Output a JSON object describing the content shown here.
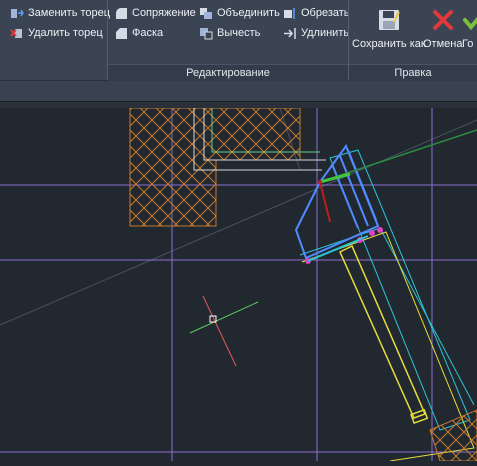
{
  "ribbon": {
    "cmd_replace_end": "Заменить торец",
    "cmd_delete_end": "Удалить торец",
    "cmd_fillet": "Сопряжение",
    "cmd_chamfer": "Фаска",
    "cmd_union": "Объединить",
    "cmd_subtract": "Вычесть",
    "cmd_trim": "Обрезать",
    "cmd_extend": "Удлинить",
    "cmd_save_as": "Сохранить как",
    "cmd_cancel": "Отмена",
    "cmd_done_partial": "Го",
    "panel_edit": "Редактирование",
    "panel_edit_title": "Правка"
  },
  "icons": {
    "replace_end": "replace-end-icon",
    "delete_end": "delete-end-icon",
    "fillet": "fillet-icon",
    "chamfer": "chamfer-icon",
    "union": "union-icon",
    "subtract": "subtract-icon",
    "trim": "trim-icon",
    "extend": "extend-icon",
    "save_as": "floppy-save-icon",
    "cancel": "red-x-icon",
    "done": "green-check-icon"
  },
  "colors": {
    "ribbon_bg": "#3b4453",
    "canvas_bg": "#212830",
    "hatch": "#c87a2a",
    "grid_purple": "#8a6fd4",
    "selection_blue": "#4f8cff",
    "cyan_outline": "#2bc6d6",
    "yellow_outline": "#e6dc3a",
    "grip_magenta": "#e040c8",
    "cancel_red": "#e03a3a",
    "done_green": "#7cc13e"
  }
}
